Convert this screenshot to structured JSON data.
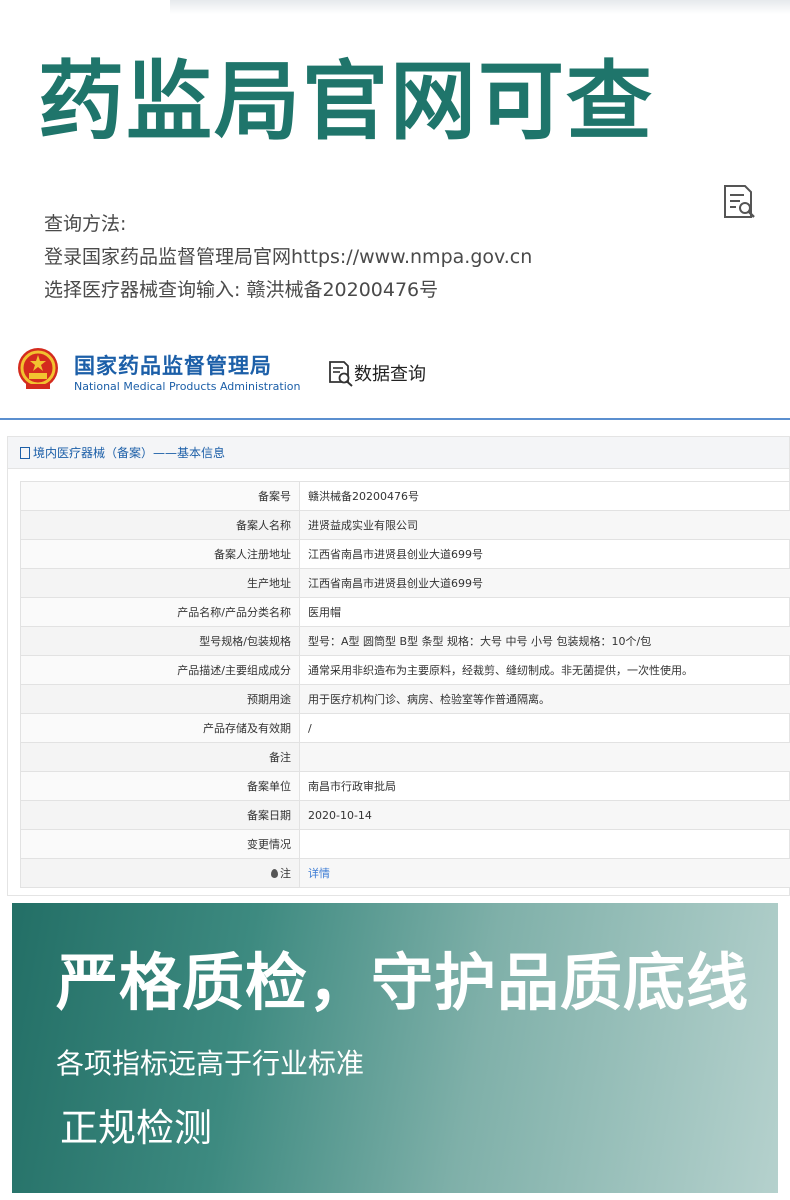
{
  "hero": {
    "title": "药监局官网可查"
  },
  "method": {
    "heading": "查询方法:",
    "line1": "登录国家药品监督管理局官网https://www.nmpa.gov.cn",
    "line2": "选择医疗器械查询输入: 赣洪械备20200476号"
  },
  "site": {
    "name_cn": "国家药品监督管理局",
    "name_en": "National Medical Products Administration",
    "query_label": "数据查询",
    "colors": {
      "brand": "#1c5fa8",
      "accent": "#1f756b"
    }
  },
  "panel": {
    "title": "境内医疗器械（备案）——基本信息",
    "rows": [
      {
        "label": "备案号",
        "value": "赣洪械备20200476号"
      },
      {
        "label": "备案人名称",
        "value": "进贤益成实业有限公司"
      },
      {
        "label": "备案人注册地址",
        "value": "江西省南昌市进贤县创业大道699号"
      },
      {
        "label": "生产地址",
        "value": "江西省南昌市进贤县创业大道699号"
      },
      {
        "label": "产品名称/产品分类名称",
        "value": "医用帽"
      },
      {
        "label": "型号规格/包装规格",
        "value": "型号：A型 圆筒型 B型 条型 规格：大号 中号 小号 包装规格：10个/包"
      },
      {
        "label": "产品描述/主要组成成分",
        "value": "通常采用非织造布为主要原料，经裁剪、缝纫制成。非无菌提供，一次性使用。"
      },
      {
        "label": "预期用途",
        "value": "用于医疗机构门诊、病房、检验室等作普通隔离。"
      },
      {
        "label": "产品存储及有效期",
        "value": "/"
      },
      {
        "label": "备注",
        "value": ""
      },
      {
        "label": "备案单位",
        "value": "南昌市行政审批局"
      },
      {
        "label": "备案日期",
        "value": "2020-10-14"
      },
      {
        "label": "变更情况",
        "value": ""
      }
    ],
    "note_label": "注",
    "note_link": "详情"
  },
  "banner": {
    "title": "严格质检，守护品质底线",
    "subtitle": "各项指标远高于行业标准",
    "tag": "正规检测"
  }
}
